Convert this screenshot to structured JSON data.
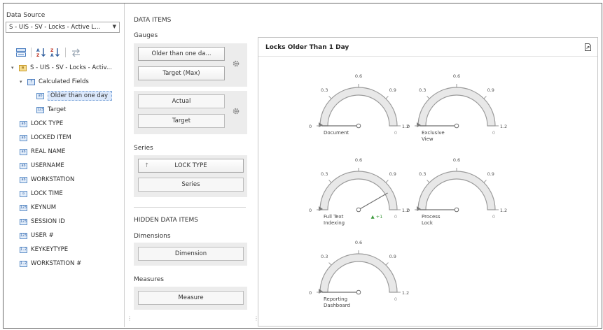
{
  "data_source": {
    "label": "Data Source",
    "selected": "S - UIS - SV - Locks - Active L..."
  },
  "toolbar": {
    "icons": [
      "group-by-type-icon",
      "sort-ascending-icon",
      "sort-descending-icon",
      "refresh-icon"
    ]
  },
  "tree": {
    "root": "S - UIS - SV - Locks - Activ...",
    "calculated_folder": "Calculated Fields",
    "calculated": [
      {
        "label": "Older than one day",
        "type": "ab",
        "selected": true
      },
      {
        "label": "Target",
        "type": "123"
      }
    ],
    "fields": [
      {
        "label": "LOCK TYPE",
        "type": "ab"
      },
      {
        "label": "LOCKED ITEM",
        "type": "ab"
      },
      {
        "label": "REAL NAME",
        "type": "ab"
      },
      {
        "label": "USERNAME",
        "type": "ab"
      },
      {
        "label": "WORKSTATION",
        "type": "ab"
      },
      {
        "label": "LOCK TIME",
        "type": "clock"
      },
      {
        "label": "KEYNUM",
        "type": "123"
      },
      {
        "label": "SESSION ID",
        "type": "123"
      },
      {
        "label": "USER #",
        "type": "123"
      },
      {
        "label": "KEYKEYTYPE",
        "type": "1.2"
      },
      {
        "label": "WORKSTATION #",
        "type": "1.2"
      }
    ]
  },
  "data_items": {
    "title": "DATA ITEMS",
    "gauges_label": "Gauges",
    "gauge1_actual": "Older than one da...",
    "gauge1_target": "Target (Max)",
    "gauge2_actual": "Actual",
    "gauge2_target": "Target",
    "series_label": "Series",
    "series_value": "LOCK TYPE",
    "series_placeholder": "Series",
    "hidden_title": "HIDDEN DATA ITEMS",
    "dimensions_label": "Dimensions",
    "dimension_placeholder": "Dimension",
    "measures_label": "Measures",
    "measure_placeholder": "Measure"
  },
  "dashboard_item": {
    "title": "Locks Older Than 1 Day",
    "gauges": [
      {
        "name1": "Document",
        "name2": "",
        "value": 0,
        "delta": ""
      },
      {
        "name1": "Exclusive",
        "name2": "View",
        "value": 0,
        "delta": ""
      },
      {
        "name1": "Full Text",
        "name2": "Indexing",
        "value": 1,
        "delta": "+1"
      },
      {
        "name1": "Process",
        "name2": "Lock",
        "value": 0,
        "delta": ""
      },
      {
        "name1": "Reporting",
        "name2": "Dashboard",
        "value": 0,
        "delta": ""
      }
    ],
    "scale": {
      "min": 0,
      "max": 1.2,
      "ticks": [
        "0",
        "0.3",
        "0.6",
        "0.9",
        "1.2"
      ]
    },
    "value_text": "0"
  },
  "colors": {
    "gauge_fill": "#e8e8e8",
    "gauge_needle": "#707070",
    "delta_up": "#3c9a3c",
    "selection": "#dbe8fb"
  }
}
